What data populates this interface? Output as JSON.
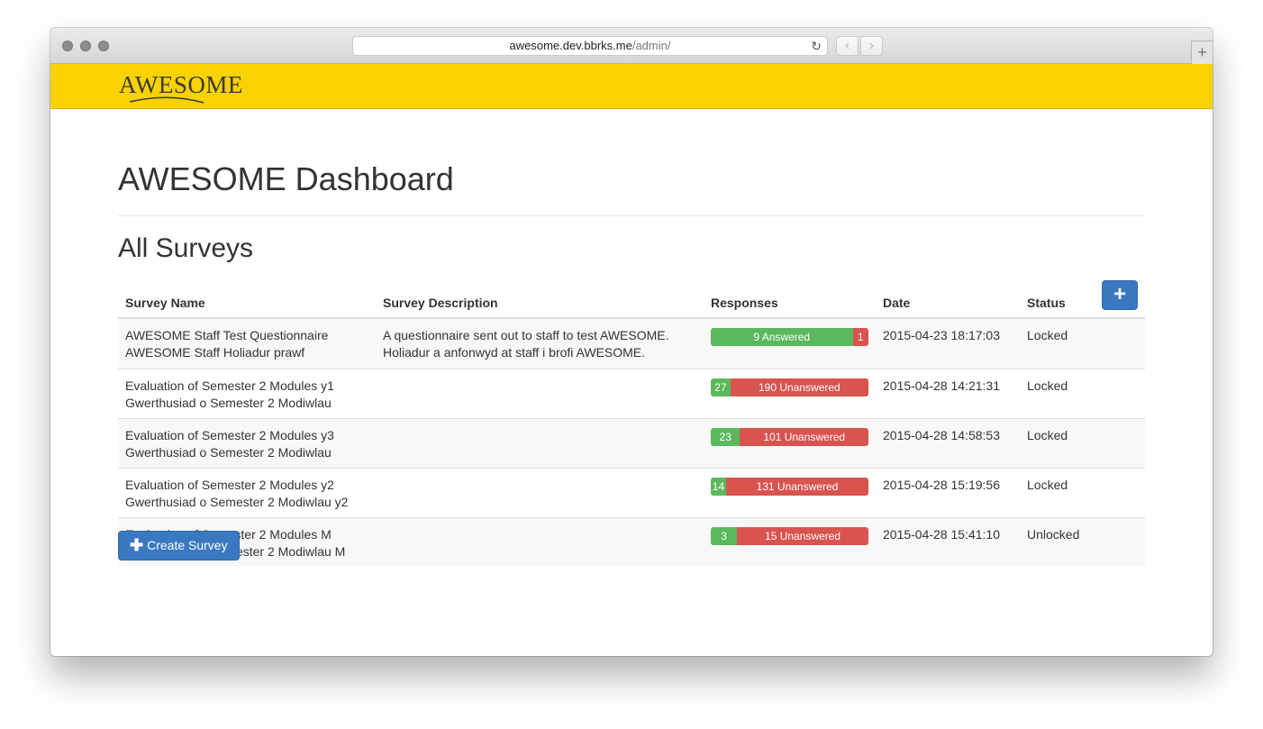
{
  "browser": {
    "url_host": "awesome.dev.bbrks.me",
    "url_path": "/admin/",
    "reload_icon": "reload-icon",
    "back_icon": "chevron-left-icon",
    "forward_icon": "chevron-right-icon",
    "new_tab_label": "+"
  },
  "header": {
    "logo_text": "AWESOME",
    "background": "#f9d200"
  },
  "page": {
    "title": "AWESOME Dashboard",
    "section_title": "All Surveys"
  },
  "table": {
    "columns": [
      "Survey Name",
      "Survey Description",
      "Responses",
      "Date",
      "Status"
    ],
    "add_label": "+",
    "rows": [
      {
        "name_en": "AWESOME Staff Test Questionnaire",
        "name_cy": "AWESOME Staff Holiadur prawf",
        "desc_en": "A questionnaire sent out to staff to test AWESOME.",
        "desc_cy": "Holiadur a anfonwyd at staff i brofi AWESOME.",
        "answered": 9,
        "unanswered": 1,
        "answered_label": "9 Answered",
        "unanswered_label": "1",
        "date": "2015-04-23 18:17:03",
        "status": "Locked"
      },
      {
        "name_en": "Evaluation of Semester 2 Modules y1",
        "name_cy": "Gwerthusiad o Semester 2 Modiwlau",
        "desc_en": "",
        "desc_cy": "",
        "answered": 27,
        "unanswered": 190,
        "answered_label": "27",
        "unanswered_label": "190 Unanswered",
        "date": "2015-04-28 14:21:31",
        "status": "Locked"
      },
      {
        "name_en": "Evaluation of Semester 2 Modules y3",
        "name_cy": "Gwerthusiad o Semester 2 Modiwlau",
        "desc_en": "",
        "desc_cy": "",
        "answered": 23,
        "unanswered": 101,
        "answered_label": "23",
        "unanswered_label": "101 Unanswered",
        "date": "2015-04-28 14:58:53",
        "status": "Locked"
      },
      {
        "name_en": "Evaluation of Semester 2 Modules y2",
        "name_cy": "Gwerthusiad o Semester 2 Modiwlau y2",
        "desc_en": "",
        "desc_cy": "",
        "answered": 14,
        "unanswered": 131,
        "answered_label": "14",
        "unanswered_label": "131 Unanswered",
        "date": "2015-04-28 15:19:56",
        "status": "Locked"
      },
      {
        "name_en": "Evaluation of Semester 2 Modules M",
        "name_cy": "Gwerthusiad o Semester 2 Modiwlau M",
        "desc_en": "",
        "desc_cy": "",
        "answered": 3,
        "unanswered": 15,
        "answered_label": "3",
        "unanswered_label": "15 Unanswered",
        "date": "2015-04-28 15:41:10",
        "status": "Unlocked"
      }
    ]
  },
  "create_button": {
    "icon": "plus-icon",
    "label": "Create Survey"
  },
  "colors": {
    "answered": "#5cb85c",
    "unanswered": "#d9534f",
    "primary": "#3a78c0"
  }
}
